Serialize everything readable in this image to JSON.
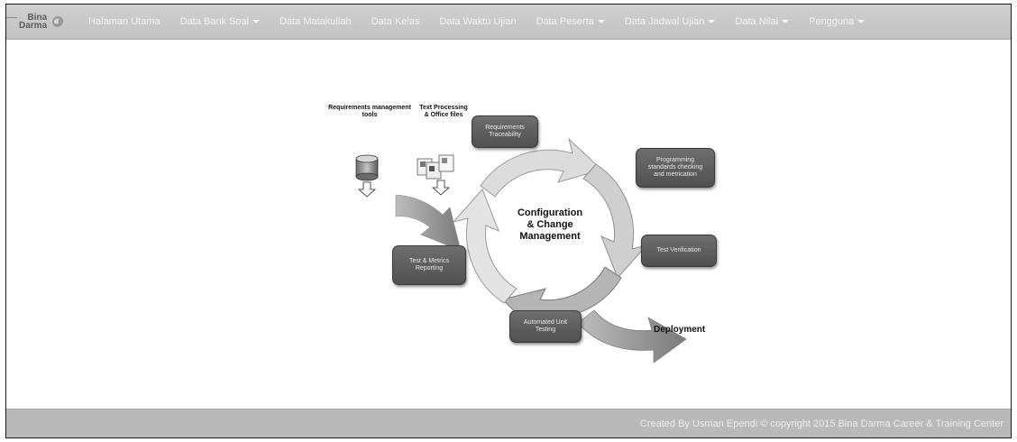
{
  "brand": {
    "line1": "Bina",
    "line2": "Darma"
  },
  "nav": {
    "items": [
      {
        "label": "Halaman Utama",
        "dropdown": false
      },
      {
        "label": "Data Bank Soal",
        "dropdown": true
      },
      {
        "label": "Data Matakuliah",
        "dropdown": false
      },
      {
        "label": "Data Kelas",
        "dropdown": false
      },
      {
        "label": "Data Waktu Ujian",
        "dropdown": false
      },
      {
        "label": "Data Peserta",
        "dropdown": true
      },
      {
        "label": "Data Jadwal Ujian",
        "dropdown": true
      },
      {
        "label": "Data Nilai",
        "dropdown": true
      },
      {
        "label": "Pengguna",
        "dropdown": true
      }
    ]
  },
  "diagram": {
    "req_tools_line1": "Requirements management",
    "req_tools_line2": "tools",
    "text_proc_line1": "Text Processing",
    "text_proc_line2": "& Office files",
    "center_line1": "Configuration",
    "center_line2": "& Change",
    "center_line3": "Management",
    "box_req_trace_line1": "Requirements",
    "box_req_trace_line2": "Traceability",
    "box_prog_line1": "Programming",
    "box_prog_line2": "standards checking",
    "box_prog_line3": "and metrication",
    "box_test_verif": "Test Verification",
    "box_test_metrics_line1": "Test & Metrics",
    "box_test_metrics_line2": "Reporting",
    "box_unit_line1": "Automated Unit",
    "box_unit_line2": "Testing",
    "deployment": "Deployment"
  },
  "footer": {
    "text": "Created By Usman Ependi © copyright 2015 Bina Darma Career & Training Center"
  },
  "colors": {
    "navbar": "#c6c6c6",
    "footer": "#b9b9b9",
    "box": "#5e5e5e"
  }
}
